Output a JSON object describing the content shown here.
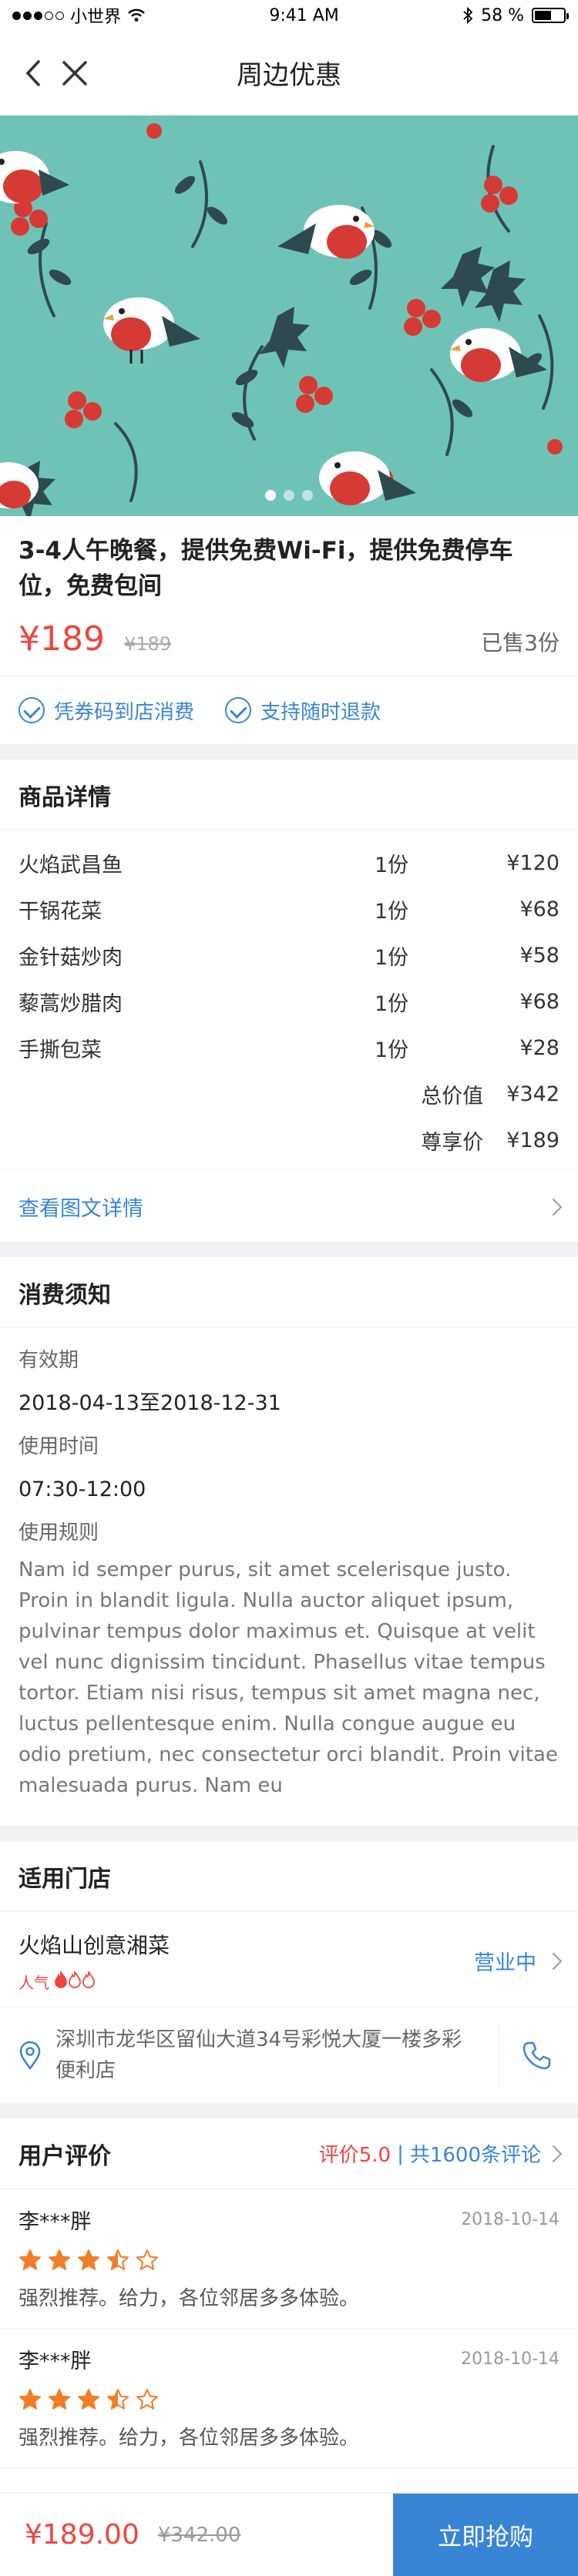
{
  "status_bar": {
    "carrier": "小世界",
    "time": "9:41 AM",
    "battery": "58 %",
    "battery_level": 0.58
  },
  "nav": {
    "title": "周边优惠"
  },
  "banner": {
    "slide_count": 3,
    "active_slide": 1
  },
  "deal": {
    "title": "3-4人午晚餐，提供免费Wi-Fi，提供免费停车位，免费包间",
    "price": "¥189",
    "original_price": "¥189",
    "sold": "已售3份",
    "guarantees": [
      "凭券码到店消费",
      "支持随时退款"
    ]
  },
  "details": {
    "title": "商品详情",
    "items": [
      {
        "name": "火焰武昌鱼",
        "qty": "1份",
        "price": "¥120"
      },
      {
        "name": "干锅花菜",
        "qty": "1份",
        "price": "¥68"
      },
      {
        "name": "金针菇炒肉",
        "qty": "1份",
        "price": "¥58"
      },
      {
        "name": "藜蒿炒腊肉",
        "qty": "1份",
        "price": "¥68"
      },
      {
        "name": "手撕包菜",
        "qty": "1份",
        "price": "¥28"
      }
    ],
    "total_label": "总价值",
    "total_value": "¥342",
    "vip_label": "尊享价",
    "vip_value": "¥189",
    "more_link": "查看图文详情"
  },
  "notice": {
    "title": "消费须知",
    "validity_label": "有效期",
    "validity_value": "2018-04-13至2018-12-31",
    "time_label": "使用时间",
    "time_value": "07:30-12:00",
    "rules_label": "使用规则",
    "rules_text": "Nam id semper purus, sit amet scelerisque justo. Proin in blandit ligula. Nulla auctor aliquet ipsum, pulvinar tempus dolor maximus et. Quisque at velit vel nunc dignissim tincidunt. Phasellus vitae tempus tortor. Etiam nisi risus, tempus sit amet magna nec, luctus pellentesque enim. Nulla congue augue eu odio pretium, nec consectetur orci blandit. Proin vitae malesuada purus. Nam eu"
  },
  "store": {
    "title": "适用门店",
    "name": "火焰山创意湘菜",
    "hot_label": "人气",
    "hot_level": 1,
    "hot_max": 3,
    "status": "营业中",
    "address": "深圳市龙华区留仙大道34号彩悦大厦一楼多彩便利店"
  },
  "reviews": {
    "title": "用户评价",
    "rating": "评价5.0",
    "separator": "|",
    "count": "共1600条评论",
    "items": [
      {
        "user": "李***胖",
        "date": "2018-10-14",
        "stars": 3.5,
        "text": "强烈推荐。给力，各位邻居多多体验。"
      },
      {
        "user": "李***胖",
        "date": "2018-10-14",
        "stars": 3.5,
        "text": "强烈推荐。给力，各位邻居多多体验。"
      }
    ]
  },
  "bottom_bar": {
    "price": "¥189.00",
    "original_price": "¥342.00",
    "buy_label": "立即抢购"
  },
  "colors": {
    "accent": "#3a84d6",
    "price": "#f0453f",
    "banner_bg": "#6fc3b6",
    "star": "#f07d28"
  }
}
